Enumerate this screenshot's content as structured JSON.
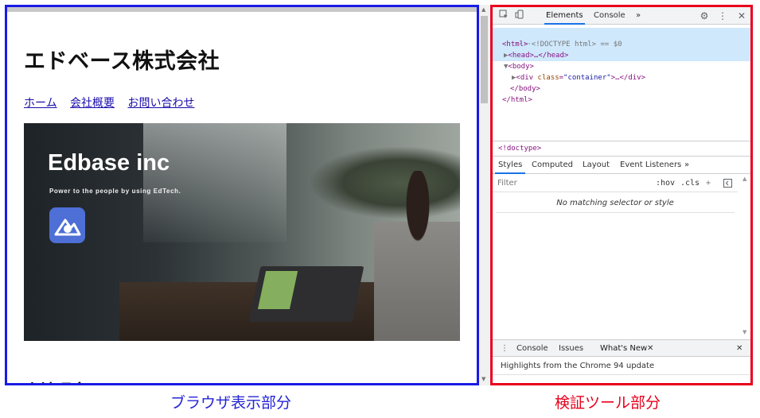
{
  "browser": {
    "site_title": "エドベース株式会社",
    "nav": [
      "ホーム",
      "会社概要",
      "お問い合わせ"
    ],
    "hero": {
      "title": "Edbase inc",
      "tagline": "Power to the people by using EdTech."
    },
    "section_heading": "会社理念"
  },
  "devtools": {
    "tabs": [
      "Elements",
      "Console"
    ],
    "more_tabs": "»",
    "dom": {
      "doctype_line": "<!DOCTYPE html>",
      "selected_marker": "== $0",
      "html_open": "<html>",
      "head_collapsed": "<head>…</head>",
      "body_open": "<body>",
      "div_tag": "div",
      "div_attr": "class",
      "div_val": "\"container\"",
      "div_end": ">…</div>",
      "body_close": "</body>",
      "html_close": "</html>"
    },
    "breadcrumb": "<!doctype>",
    "styles_tabs": [
      "Styles",
      "Computed",
      "Layout",
      "Event Listeners"
    ],
    "filter_placeholder": "Filter",
    "filter_tools": [
      ":hov",
      ".cls"
    ],
    "no_match": "No matching selector or style",
    "drawer_tabs": [
      "Console",
      "Issues",
      "What's New"
    ],
    "drawer_message": "Highlights from the Chrome 94 update"
  },
  "captions": {
    "browser": "ブラウザ表示部分",
    "devtools": "検証ツール部分"
  },
  "colors": {
    "browser_border": "#1a1ae6",
    "devtools_border": "#e8001c",
    "link": "#1a0dab",
    "tab_accent": "#1a73e8"
  }
}
